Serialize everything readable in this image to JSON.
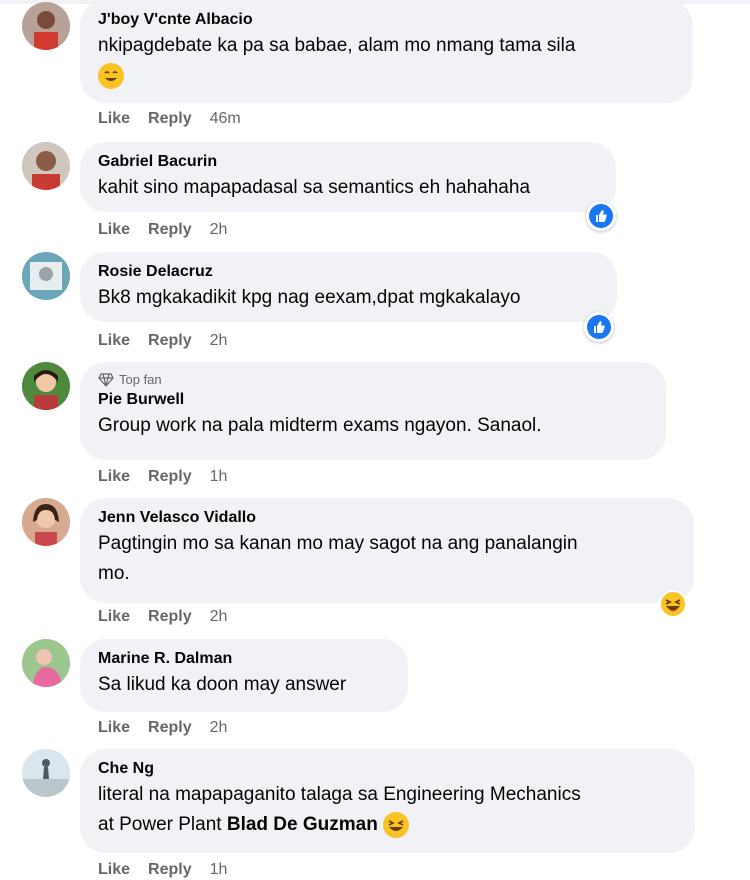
{
  "actions": {
    "like": "Like",
    "reply": "Reply"
  },
  "comments": [
    {
      "name": "J'boy V'cnte Albacio",
      "text": "nkipagdebate ka pa sa babae, alam mo nmang tama sila",
      "time": "46m"
    },
    {
      "name": "Gabriel Bacurin",
      "text": "kahit sino mapapadasal sa semantics eh hahahaha",
      "time": "2h",
      "reaction": "like-icon"
    },
    {
      "name": "Rosie Delacruz",
      "text": "Bk8 mgkakadikit kpg nag eexam,dpat mgkakalayo",
      "time": "2h",
      "reaction": "like-icon"
    },
    {
      "badge": "Top fan",
      "name": "Pie Burwell",
      "text": "Group work na pala midterm exams ngayon. Sanaol.",
      "time": "1h"
    },
    {
      "name": "Jenn Velasco Vidallo",
      "text_line1": "Pagtingin mo sa kanan mo may sagot na ang panalangin",
      "text_line2": "mo.",
      "time": "2h",
      "reaction": "laughing-emoji-icon"
    },
    {
      "name": "Marine R. Dalman",
      "text": "Sa likud ka doon may answer",
      "time": "2h"
    },
    {
      "name": "Che Ng",
      "text_line1": "literal na mapapaganito talaga sa Engineering Mechanics",
      "text_line2_prefix": "at Power Plant",
      "mention": "Blad De Guzman",
      "time": "1h"
    }
  ],
  "colors": {
    "bubble": "#f0f2f5",
    "meta": "#65676b",
    "like_blue": "#1877f2"
  }
}
